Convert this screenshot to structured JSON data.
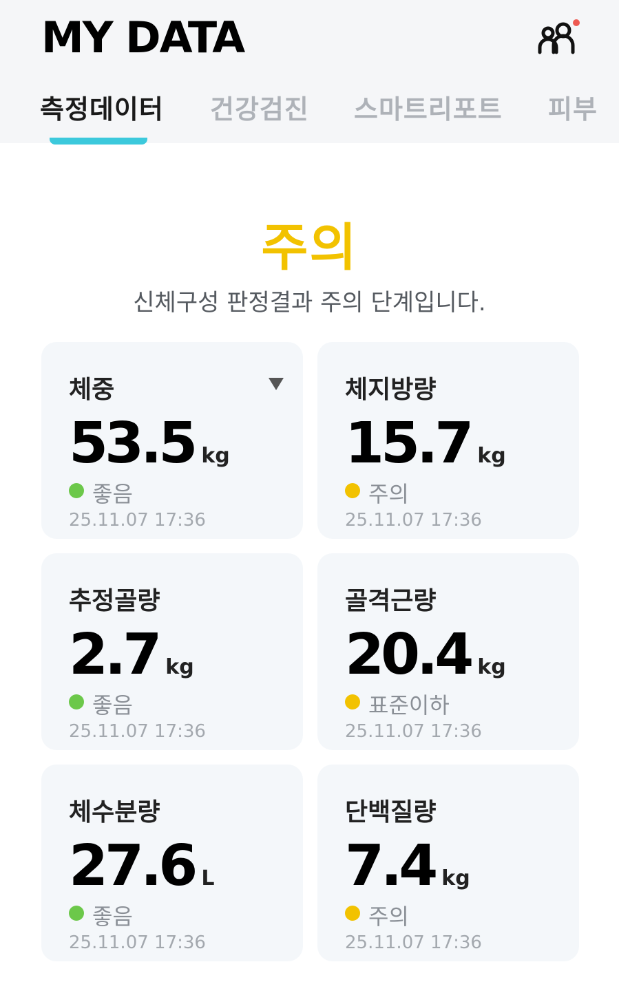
{
  "header": {
    "title": "MY DATA",
    "profile_icon": "people-icon",
    "notification_dot_color": "#ee5a52"
  },
  "tabs": [
    {
      "label": "측정데이터",
      "active": true
    },
    {
      "label": "건강검진",
      "active": false
    },
    {
      "label": "스마트리포트",
      "active": false
    },
    {
      "label": "피부",
      "active": false
    }
  ],
  "colors": {
    "accent": "#3cc9dc",
    "warning": "#f2c200",
    "good": "#6cc84a"
  },
  "summary": {
    "status": "주의",
    "description": "신체구성 판정결과 주의 단계입니다."
  },
  "cards": [
    {
      "label": "체중",
      "value": "53.5",
      "unit": "kg",
      "status": "좋음",
      "status_color": "#6cc84a",
      "time": "25.11.07 17:36",
      "has_dropdown": true
    },
    {
      "label": "체지방량",
      "value": "15.7",
      "unit": "kg",
      "status": "주의",
      "status_color": "#f2c200",
      "time": "25.11.07 17:36"
    },
    {
      "label": "추정골량",
      "value": "2.7",
      "unit": "kg",
      "status": "좋음",
      "status_color": "#6cc84a",
      "time": "25.11.07 17:36"
    },
    {
      "label": "골격근량",
      "value": "20.4",
      "unit": "kg",
      "status": "표준이하",
      "status_color": "#f2c200",
      "time": "25.11.07 17:36"
    },
    {
      "label": "체수분량",
      "value": "27.6",
      "unit": "L",
      "status": "좋음",
      "status_color": "#6cc84a",
      "time": "25.11.07 17:36"
    },
    {
      "label": "단백질량",
      "value": "7.4",
      "unit": "kg",
      "status": "주의",
      "status_color": "#f2c200",
      "time": "25.11.07 17:36"
    }
  ]
}
